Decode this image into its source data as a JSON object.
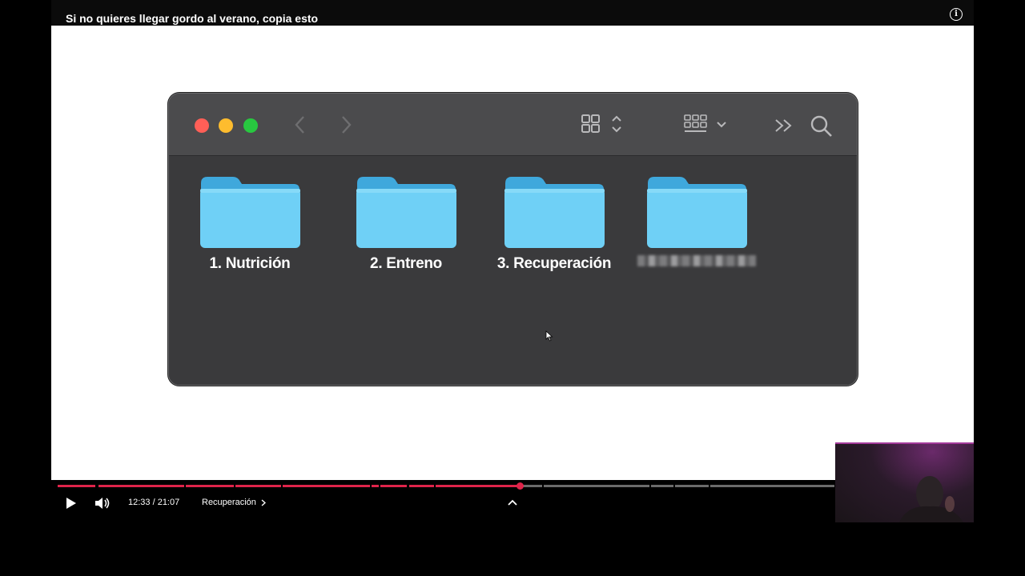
{
  "video": {
    "title": "Si no quieres llegar gordo al verano, copia esto",
    "current_time": "12:33",
    "duration": "21:07",
    "time_display": "12:33 / 21:07",
    "chapter": "Recuperación",
    "progress_fraction": 0.595
  },
  "finder": {
    "folders": [
      {
        "label": "1. Nutrición"
      },
      {
        "label": "2. Entreno"
      },
      {
        "label": "3. Recuperación"
      },
      {
        "label": ""
      }
    ],
    "folder_color": "#5bc3f0"
  },
  "colors": {
    "progress_played": "#e0244a",
    "progress_unplayed": "#6b6b6b"
  },
  "icons": [
    "info-icon",
    "close-icon",
    "minimize-icon",
    "zoom-icon",
    "back-icon",
    "forward-icon",
    "grid-view-icon",
    "group-view-icon",
    "more-icon",
    "search-icon",
    "folder-icon",
    "cursor-icon",
    "play-icon",
    "volume-icon",
    "chevron-right-icon",
    "chevron-up-icon"
  ]
}
